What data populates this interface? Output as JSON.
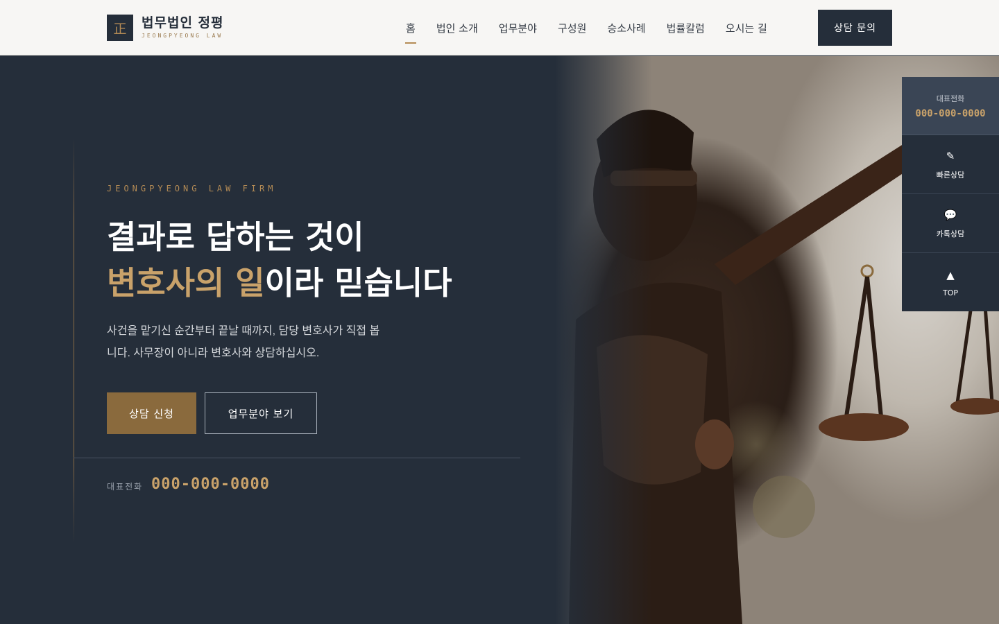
{
  "header": {
    "logo_mark": "正",
    "logo_title": "법무법인 정평",
    "logo_sub": "JEONGPYEONG LAW",
    "nav": [
      {
        "label": "홈"
      },
      {
        "label": "법인 소개"
      },
      {
        "label": "업무분야"
      },
      {
        "label": "구성원"
      },
      {
        "label": "승소사례"
      },
      {
        "label": "법률칼럼"
      },
      {
        "label": "오시는 길"
      }
    ],
    "cta_label": "상담 문의"
  },
  "hero": {
    "eyebrow": "JEONGPYEONG LAW FIRM",
    "headline_line1": "결과로 답하는 것이",
    "headline_gold": "변호사의 일",
    "headline_rest": "이라 믿습니다",
    "description": "사건을 맡기신 순간부터 끝날 때까지, 담당 변호사가 직접 봅니다. 사무장이 아니라 변호사와 상담하십시오.",
    "primary_button": "상담 신청",
    "secondary_button": "업무분야 보기",
    "phone_label": "대표전화",
    "phone_number": "000-000-0000"
  },
  "quick_menu": {
    "phone_label": "대표전화",
    "phone_number": "000-000-0000",
    "items": [
      {
        "icon": "pencil-icon",
        "glyph": "✎",
        "label": "빠른상담"
      },
      {
        "icon": "chat-bubble-icon",
        "glyph": "💬",
        "label": "카톡상담"
      },
      {
        "icon": "arrow-up-icon",
        "glyph": "▲",
        "label": "TOP"
      }
    ]
  },
  "colors": {
    "navy": "#252e3a",
    "gold": "#b48b55",
    "gold_light": "#c9a26a",
    "header_bg": "#f7f6f4"
  }
}
